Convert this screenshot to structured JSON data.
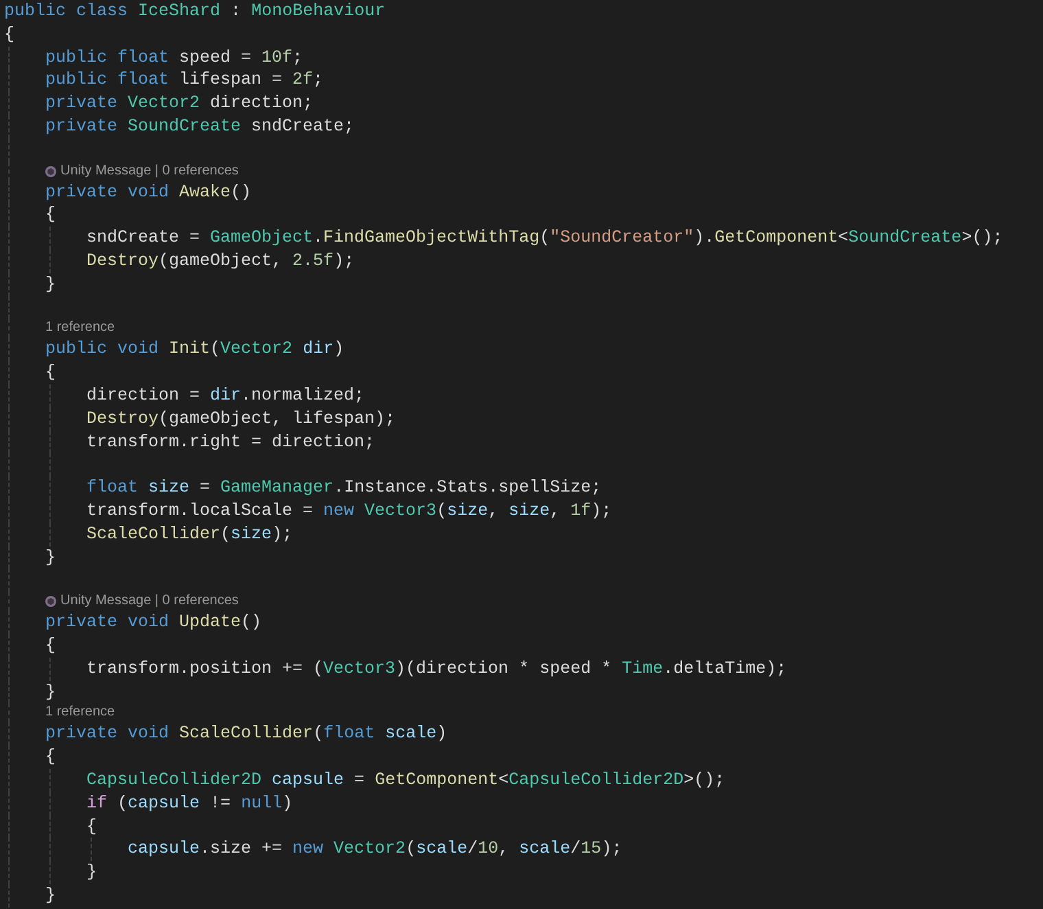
{
  "editor": {
    "lines": [
      {
        "kind": "code",
        "tokens": [
          {
            "kind": "keyword",
            "text": "public class "
          },
          {
            "kind": "type",
            "text": "IceShard"
          },
          {
            "kind": "plain",
            "text": " : "
          },
          {
            "kind": "type",
            "text": "MonoBehaviour"
          }
        ]
      },
      {
        "kind": "code",
        "tokens": [
          {
            "kind": "plain",
            "text": "{"
          }
        ],
        "children": [
          {
            "kind": "code",
            "tokens": [
              {
                "kind": "keyword",
                "text": "public float"
              },
              {
                "kind": "plain",
                "text": " speed = "
              },
              {
                "kind": "number",
                "text": "10f"
              },
              {
                "kind": "plain",
                "text": ";"
              }
            ]
          },
          {
            "kind": "code",
            "tokens": [
              {
                "kind": "keyword",
                "text": "public float"
              },
              {
                "kind": "plain",
                "text": " lifespan = "
              },
              {
                "kind": "number",
                "text": "2f"
              },
              {
                "kind": "plain",
                "text": ";"
              }
            ]
          },
          {
            "kind": "code",
            "tokens": [
              {
                "kind": "keyword",
                "text": "private "
              },
              {
                "kind": "type",
                "text": "Vector2"
              },
              {
                "kind": "plain",
                "text": " direction;"
              }
            ]
          },
          {
            "kind": "code",
            "tokens": [
              {
                "kind": "keyword",
                "text": "private "
              },
              {
                "kind": "type",
                "text": "SoundCreate"
              },
              {
                "kind": "plain",
                "text": " sndCreate;"
              }
            ]
          },
          {
            "kind": "blank"
          },
          {
            "kind": "lens",
            "unity_icon": true,
            "text": "Unity Message | 0 references"
          },
          {
            "kind": "code",
            "tokens": [
              {
                "kind": "keyword",
                "text": "private void "
              },
              {
                "kind": "method",
                "text": "Awake"
              },
              {
                "kind": "plain",
                "text": "()"
              }
            ]
          },
          {
            "kind": "code",
            "tokens": [
              {
                "kind": "plain",
                "text": "{"
              }
            ],
            "children": [
              {
                "kind": "code",
                "tokens": [
                  {
                    "kind": "plain",
                    "text": "sndCreate = "
                  },
                  {
                    "kind": "type",
                    "text": "GameObject"
                  },
                  {
                    "kind": "plain",
                    "text": "."
                  },
                  {
                    "kind": "method",
                    "text": "FindGameObjectWithTag"
                  },
                  {
                    "kind": "plain",
                    "text": "("
                  },
                  {
                    "kind": "string",
                    "text": "\"SoundCreator\""
                  },
                  {
                    "kind": "plain",
                    "text": ")."
                  },
                  {
                    "kind": "method",
                    "text": "GetComponent"
                  },
                  {
                    "kind": "plain",
                    "text": "<"
                  },
                  {
                    "kind": "type",
                    "text": "SoundCreate"
                  },
                  {
                    "kind": "plain",
                    "text": ">();"
                  }
                ]
              },
              {
                "kind": "code",
                "tokens": [
                  {
                    "kind": "method",
                    "text": "Destroy"
                  },
                  {
                    "kind": "plain",
                    "text": "(gameObject, "
                  },
                  {
                    "kind": "number",
                    "text": "2.5f"
                  },
                  {
                    "kind": "plain",
                    "text": ");"
                  }
                ]
              }
            ]
          },
          {
            "kind": "code",
            "tokens": [
              {
                "kind": "plain",
                "text": "}"
              }
            ]
          },
          {
            "kind": "blank"
          },
          {
            "kind": "lens",
            "unity_icon": false,
            "text": "1 reference"
          },
          {
            "kind": "code",
            "tokens": [
              {
                "kind": "keyword",
                "text": "public void "
              },
              {
                "kind": "method",
                "text": "Init"
              },
              {
                "kind": "plain",
                "text": "("
              },
              {
                "kind": "type",
                "text": "Vector2 "
              },
              {
                "kind": "parameter",
                "text": "dir"
              },
              {
                "kind": "plain",
                "text": ")"
              }
            ]
          },
          {
            "kind": "code",
            "tokens": [
              {
                "kind": "plain",
                "text": "{"
              }
            ],
            "children": [
              {
                "kind": "code",
                "tokens": [
                  {
                    "kind": "plain",
                    "text": "direction = "
                  },
                  {
                    "kind": "parameter",
                    "text": "dir"
                  },
                  {
                    "kind": "plain",
                    "text": ".normalized;"
                  }
                ]
              },
              {
                "kind": "code",
                "tokens": [
                  {
                    "kind": "method",
                    "text": "Destroy"
                  },
                  {
                    "kind": "plain",
                    "text": "(gameObject, lifespan);"
                  }
                ]
              },
              {
                "kind": "code",
                "tokens": [
                  {
                    "kind": "plain",
                    "text": "transform.right = direction;"
                  }
                ]
              },
              {
                "kind": "blank"
              },
              {
                "kind": "code",
                "tokens": [
                  {
                    "kind": "keyword",
                    "text": "float "
                  },
                  {
                    "kind": "parameter",
                    "text": "size"
                  },
                  {
                    "kind": "plain",
                    "text": " = "
                  },
                  {
                    "kind": "type",
                    "text": "GameManager"
                  },
                  {
                    "kind": "plain",
                    "text": ".Instance.Stats.spellSize;"
                  }
                ]
              },
              {
                "kind": "code",
                "tokens": [
                  {
                    "kind": "plain",
                    "text": "transform.localScale = "
                  },
                  {
                    "kind": "keyword",
                    "text": "new "
                  },
                  {
                    "kind": "type",
                    "text": "Vector3"
                  },
                  {
                    "kind": "plain",
                    "text": "("
                  },
                  {
                    "kind": "parameter",
                    "text": "size"
                  },
                  {
                    "kind": "plain",
                    "text": ", "
                  },
                  {
                    "kind": "parameter",
                    "text": "size"
                  },
                  {
                    "kind": "plain",
                    "text": ", "
                  },
                  {
                    "kind": "number",
                    "text": "1f"
                  },
                  {
                    "kind": "plain",
                    "text": ");"
                  }
                ]
              },
              {
                "kind": "code",
                "tokens": [
                  {
                    "kind": "method",
                    "text": "ScaleCollider"
                  },
                  {
                    "kind": "plain",
                    "text": "("
                  },
                  {
                    "kind": "parameter",
                    "text": "size"
                  },
                  {
                    "kind": "plain",
                    "text": ");"
                  }
                ]
              }
            ]
          },
          {
            "kind": "code",
            "tokens": [
              {
                "kind": "plain",
                "text": "}"
              }
            ]
          },
          {
            "kind": "blank"
          },
          {
            "kind": "lens",
            "unity_icon": true,
            "text": "Unity Message | 0 references"
          },
          {
            "kind": "code",
            "tokens": [
              {
                "kind": "keyword",
                "text": "private void "
              },
              {
                "kind": "method",
                "text": "Update"
              },
              {
                "kind": "plain",
                "text": "()"
              }
            ]
          },
          {
            "kind": "code",
            "tokens": [
              {
                "kind": "plain",
                "text": "{"
              }
            ],
            "children": [
              {
                "kind": "code",
                "tokens": [
                  {
                    "kind": "plain",
                    "text": "transform.position += ("
                  },
                  {
                    "kind": "type",
                    "text": "Vector3"
                  },
                  {
                    "kind": "plain",
                    "text": ")(direction * speed * "
                  },
                  {
                    "kind": "type",
                    "text": "Time"
                  },
                  {
                    "kind": "plain",
                    "text": ".deltaTime);"
                  }
                ]
              }
            ]
          },
          {
            "kind": "code",
            "tokens": [
              {
                "kind": "plain",
                "text": "}"
              }
            ]
          },
          {
            "kind": "lens",
            "unity_icon": false,
            "text": "1 reference"
          },
          {
            "kind": "code",
            "tokens": [
              {
                "kind": "keyword",
                "text": "private void "
              },
              {
                "kind": "method",
                "text": "ScaleCollider"
              },
              {
                "kind": "plain",
                "text": "("
              },
              {
                "kind": "keyword",
                "text": "float "
              },
              {
                "kind": "parameter",
                "text": "scale"
              },
              {
                "kind": "plain",
                "text": ")"
              }
            ]
          },
          {
            "kind": "code",
            "tokens": [
              {
                "kind": "plain",
                "text": "{"
              }
            ],
            "children": [
              {
                "kind": "code",
                "tokens": [
                  {
                    "kind": "type",
                    "text": "CapsuleCollider2D "
                  },
                  {
                    "kind": "parameter",
                    "text": "capsule"
                  },
                  {
                    "kind": "plain",
                    "text": " = "
                  },
                  {
                    "kind": "method",
                    "text": "GetComponent"
                  },
                  {
                    "kind": "plain",
                    "text": "<"
                  },
                  {
                    "kind": "type",
                    "text": "CapsuleCollider2D"
                  },
                  {
                    "kind": "plain",
                    "text": ">();"
                  }
                ]
              },
              {
                "kind": "code",
                "tokens": [
                  {
                    "kind": "control",
                    "text": "if"
                  },
                  {
                    "kind": "plain",
                    "text": " ("
                  },
                  {
                    "kind": "parameter",
                    "text": "capsule"
                  },
                  {
                    "kind": "plain",
                    "text": " != "
                  },
                  {
                    "kind": "keyword",
                    "text": "null"
                  },
                  {
                    "kind": "plain",
                    "text": ")"
                  }
                ]
              },
              {
                "kind": "code",
                "tokens": [
                  {
                    "kind": "plain",
                    "text": "{"
                  }
                ],
                "children": [
                  {
                    "kind": "code",
                    "tokens": [
                      {
                        "kind": "parameter",
                        "text": "capsule"
                      },
                      {
                        "kind": "plain",
                        "text": ".size += "
                      },
                      {
                        "kind": "keyword",
                        "text": "new "
                      },
                      {
                        "kind": "type",
                        "text": "Vector2"
                      },
                      {
                        "kind": "plain",
                        "text": "("
                      },
                      {
                        "kind": "parameter",
                        "text": "scale"
                      },
                      {
                        "kind": "plain",
                        "text": "/"
                      },
                      {
                        "kind": "number",
                        "text": "10"
                      },
                      {
                        "kind": "plain",
                        "text": ", "
                      },
                      {
                        "kind": "parameter",
                        "text": "scale"
                      },
                      {
                        "kind": "plain",
                        "text": "/"
                      },
                      {
                        "kind": "number",
                        "text": "15"
                      },
                      {
                        "kind": "plain",
                        "text": ");"
                      }
                    ]
                  }
                ]
              },
              {
                "kind": "code",
                "tokens": [
                  {
                    "kind": "plain",
                    "text": "}"
                  }
                ]
              }
            ]
          },
          {
            "kind": "code",
            "tokens": [
              {
                "kind": "plain",
                "text": "}"
              }
            ]
          }
        ]
      }
    ]
  }
}
